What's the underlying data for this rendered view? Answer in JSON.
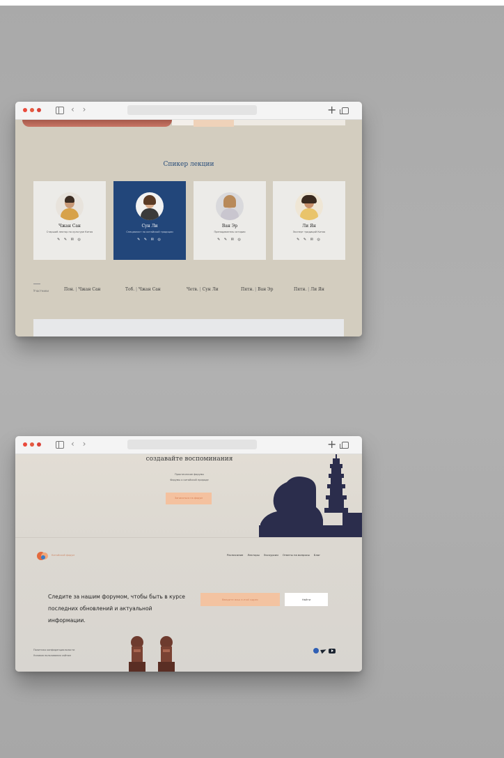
{
  "browser": {
    "address_text": "",
    "nav_glyphs": "‹ ›",
    "new_tab_glyph": "+"
  },
  "window1": {
    "banner_button": "",
    "section_title": "Спикер лекции",
    "cards": [
      {
        "name": "Чжан Сан",
        "role": "Старший лектор по культуре Китая",
        "social": "✎ ✎ ✉ ◎",
        "active": false
      },
      {
        "name": "Сун Ли",
        "role": "Специалист по китайской традиции",
        "social": "✎ ✎ ✉ ◎",
        "active": true
      },
      {
        "name": "Ван Эр",
        "role": "Преподаватель истории",
        "social": "✎ ✎ ✉ ◎",
        "active": false
      },
      {
        "name": "Ли Ян",
        "role": "Эксперт традиций Китая",
        "social": "✎ ✎ ✉ ◎",
        "active": false
      }
    ],
    "ticker_label": "Участники",
    "ticker_items": [
      {
        "day": "Пон.",
        "name": "Чжан Сан"
      },
      {
        "day": "Тоб.",
        "name": "Чжан Сан"
      },
      {
        "day": "Четв.",
        "name": "Сун Ли"
      },
      {
        "day": "Пятн.",
        "name": "Ван Эр"
      },
      {
        "day": "Пятн.",
        "name": "Ли Ян"
      }
    ]
  },
  "window2": {
    "hero": {
      "title": "создавайте воспоминания",
      "line1": "Практические форумы",
      "line2": "Форумы о китайской природе",
      "button": "Записаться на форум"
    },
    "logo_text": "Китайский форум",
    "menu": [
      "Расписание",
      "Лекторы",
      "Экскурсии",
      "Ответы на вопросы",
      "Блог"
    ],
    "cta_text": "Следите за нашим форумом, чтобы быть в курсе последних обновлений и актуальной информации.",
    "subscribe_placeholder": "Введите ваш e-mail адрес",
    "subscribe_button": "Найти",
    "footer_line1": "Политика конфиденциальности",
    "footer_line2": "Условия пользования сайтом"
  },
  "colors": {
    "accent_blue": "#22467a",
    "accent_peach": "#f4c19f",
    "accent_orange": "#d87b4f",
    "page_beige": "#d3cdbf",
    "dark_navy": "#262b35"
  }
}
